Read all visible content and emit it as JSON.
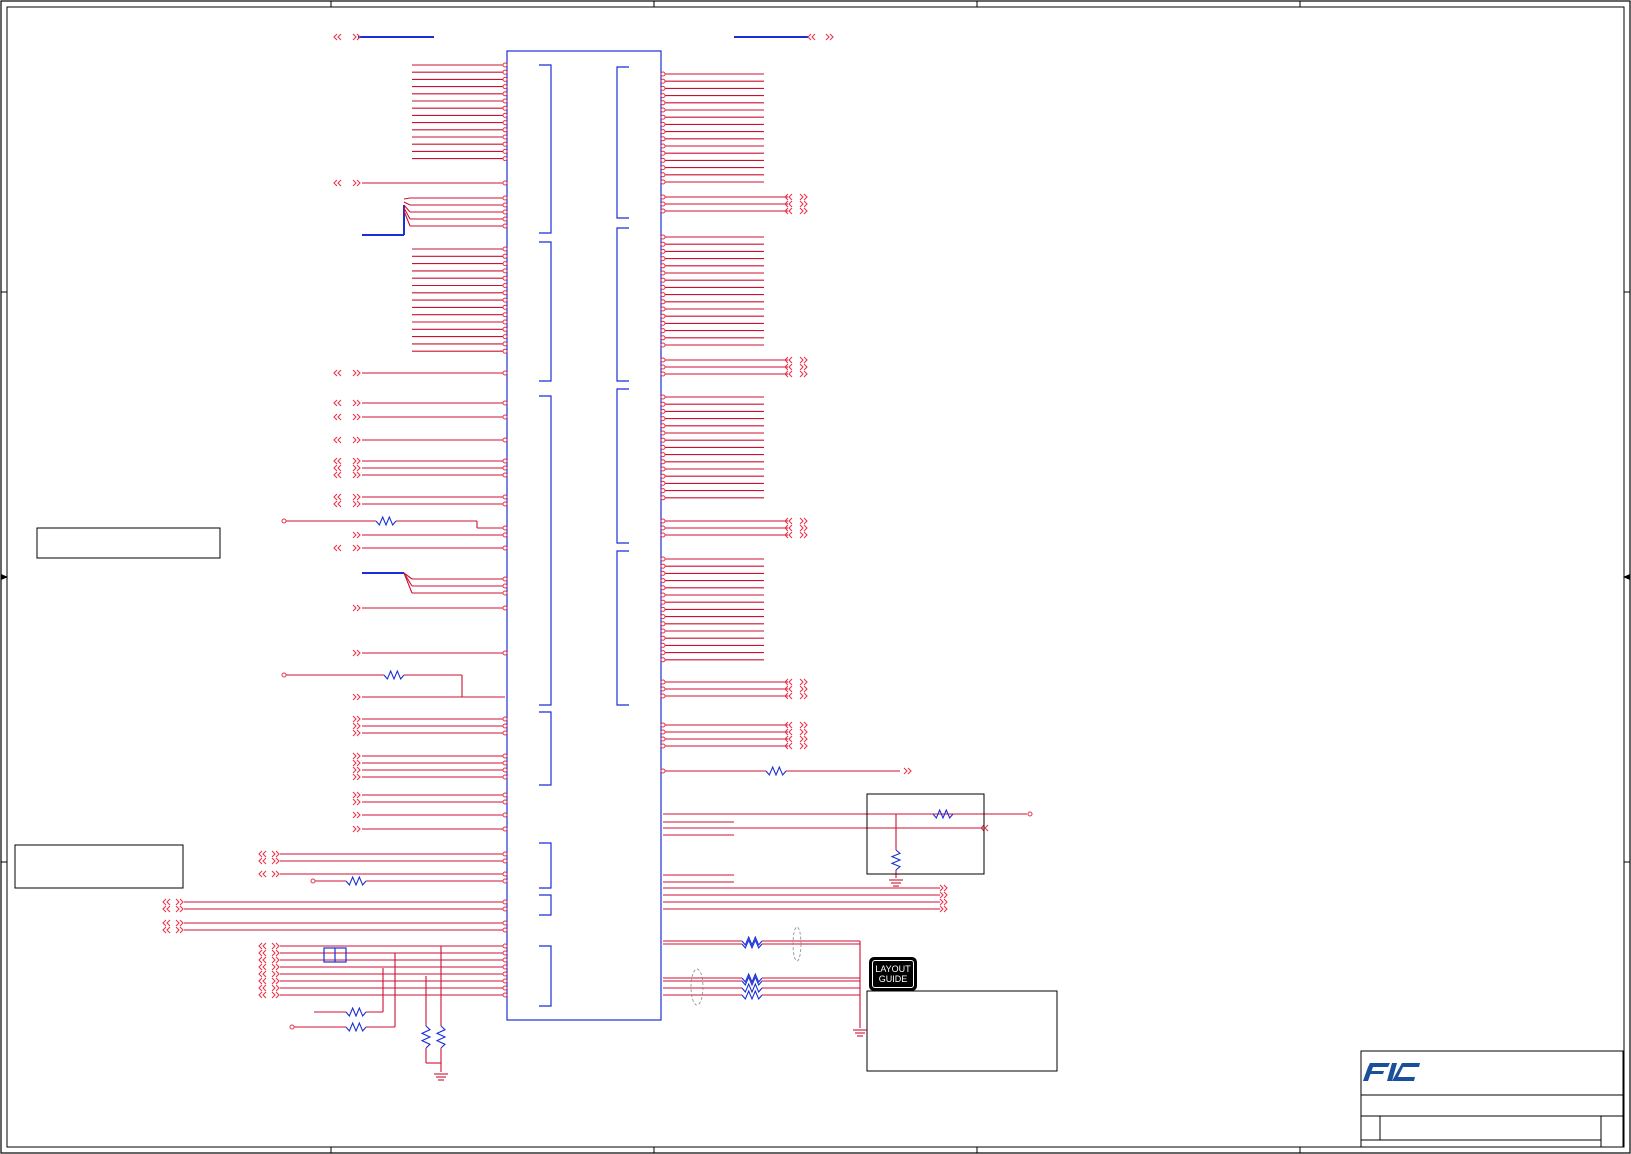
{
  "layout_guide": {
    "line1": "LAYOUT",
    "line2": "GUIDE"
  },
  "colors": {
    "wire": "#cc1133",
    "pin_dot": "#e8354c",
    "component": "#1a2fd6",
    "junction": "#cc33cc",
    "frame": "#000000",
    "logo": "#1a4f9c"
  },
  "icons": {
    "connector": "double-chevron-icon",
    "resistor": "resistor-zigzag-icon",
    "ground": "ground-symbol-icon",
    "capacitor": "capacitor-icon",
    "logo": "fic-logo-icon"
  }
}
